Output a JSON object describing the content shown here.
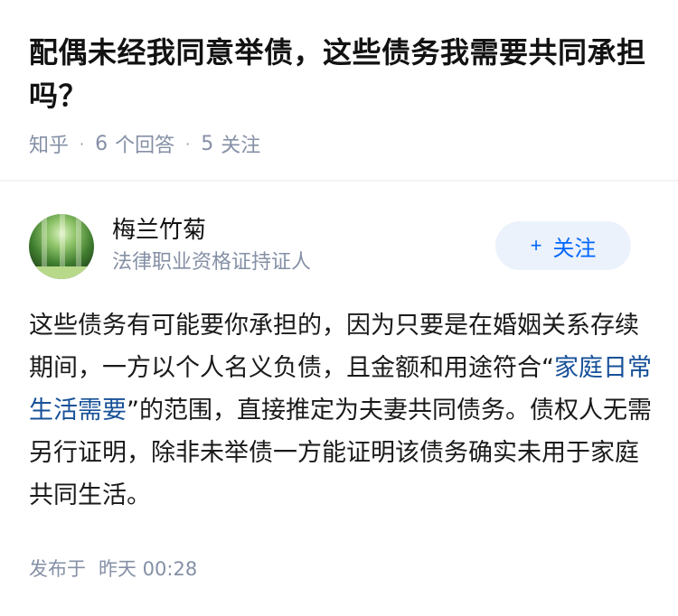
{
  "question": {
    "title": "配偶未经我同意举债，这些债务我需要共同承担吗？",
    "source": "知乎",
    "answers_count": "6",
    "answers_label": "个回答",
    "followers_count": "5",
    "followers_label": "关注"
  },
  "answer": {
    "author": {
      "name": "梅兰竹菊",
      "bio": "法律职业资格证持证人",
      "avatar_icon": "forest-avatar"
    },
    "follow_button": {
      "icon": "plus-icon",
      "label": "关注"
    },
    "content": {
      "part1": "这些债务有可能要你承担的，因为只要是在婚姻关系存续期间，一方以个人名义负债，且金额和用途符合“",
      "link": "家庭日常生活需要",
      "part2": "”的范围，直接推定为夫妻共同债务。债权人无需另行证明，除非未举债一方能证明该债务确实未用于家庭共同生活。"
    },
    "publish": {
      "prefix": "发布于",
      "time": "昨天 00:28"
    }
  },
  "colors": {
    "accent": "#0066ff",
    "link": "#175199",
    "muted": "#8590a6"
  }
}
